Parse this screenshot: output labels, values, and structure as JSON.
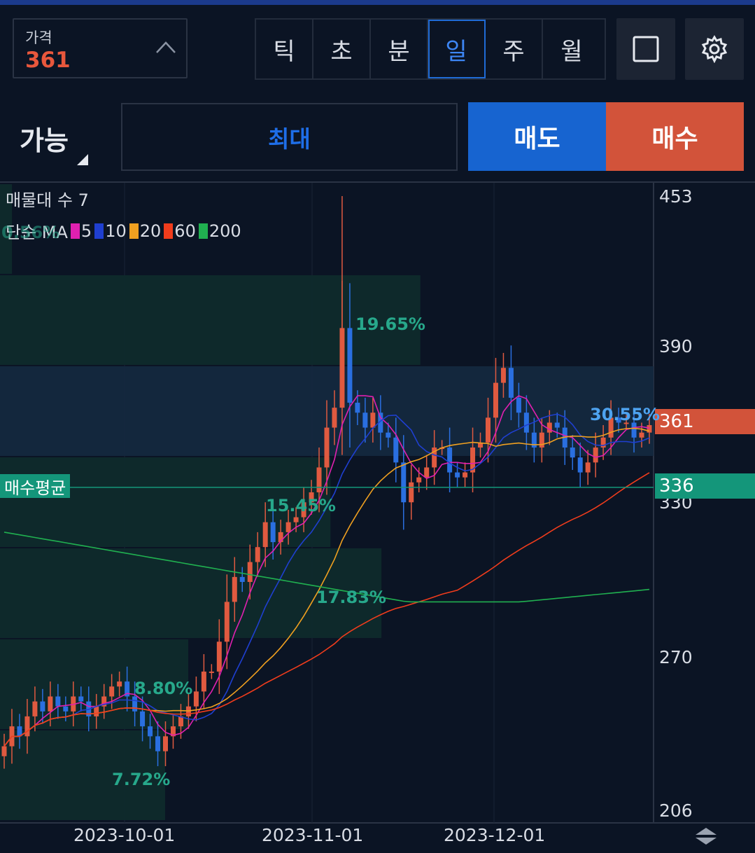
{
  "price_box": {
    "label": "가격",
    "value": "361"
  },
  "period_tabs": [
    "틱",
    "초",
    "분",
    "일",
    "주",
    "월"
  ],
  "active_tab": "일",
  "icons": {
    "expand": "square-icon",
    "settings": "gear-icon",
    "price_toggle": "chevron-up-icon",
    "scroll": "updown-arrows-icon"
  },
  "order": {
    "available": "가능",
    "max": "최대",
    "sell": "매도",
    "buy": "매수"
  },
  "colors": {
    "sell": "#1764d0",
    "buy": "#d2533a",
    "up_candle": "#e05a40",
    "down_candle": "#2a6fe0",
    "avg_line": "#14967a",
    "background": "#0b1424"
  },
  "legend": {
    "volume_profile": "매물대 수 7",
    "ma_title": "단순 MA",
    "ma": [
      {
        "label": "5",
        "color": "#e020b0"
      },
      {
        "label": "10",
        "color": "#1f3fd0"
      },
      {
        "label": "20",
        "color": "#f0a020"
      },
      {
        "label": "60",
        "color": "#f03c1c"
      },
      {
        "label": "200",
        "color": "#20b050"
      }
    ]
  },
  "y_axis": [
    "453",
    "390",
    "330",
    "270",
    "206"
  ],
  "current_price_tag": "361",
  "avg_price": {
    "label": "매수평균",
    "value": "336"
  },
  "volume_profile_pcts": [
    "0.56%",
    "19.65%",
    "30.55%",
    "15.45%",
    "17.83%",
    "8.80%",
    "7.72%"
  ],
  "x_axis": [
    "2023-10-01",
    "2023-11-01",
    "2023-12-01"
  ],
  "chart_data": {
    "type": "candlestick",
    "ylim": [
      206,
      453
    ],
    "x_ticks": [
      "2023-10-01",
      "2023-11-01",
      "2023-12-01"
    ],
    "current_price": 361,
    "average_buy_price": 336,
    "volume_profile": {
      "bins": 7,
      "percent": [
        0.56,
        19.65,
        30.55,
        15.45,
        17.83,
        8.8,
        7.72
      ]
    },
    "moving_averages": [
      "5",
      "10",
      "20",
      "60",
      "200"
    ],
    "candles_close_approx": [
      232,
      240,
      236,
      244,
      250,
      246,
      252,
      248,
      246,
      252,
      250,
      244,
      248,
      252,
      256,
      258,
      252,
      246,
      240,
      236,
      230,
      236,
      240,
      244,
      248,
      254,
      262,
      262,
      274,
      290,
      300,
      298,
      306,
      312,
      322,
      314,
      318,
      322,
      324,
      330,
      334,
      344,
      360,
      368,
      400,
      370,
      366,
      360,
      366,
      358,
      356,
      346,
      330,
      338,
      340,
      344,
      352,
      352,
      342,
      340,
      342,
      352,
      354,
      364,
      378,
      384,
      372,
      366,
      358,
      352,
      358,
      362,
      360,
      352,
      348,
      342,
      346,
      352,
      356,
      364,
      362,
      362,
      356,
      358,
      361
    ]
  }
}
